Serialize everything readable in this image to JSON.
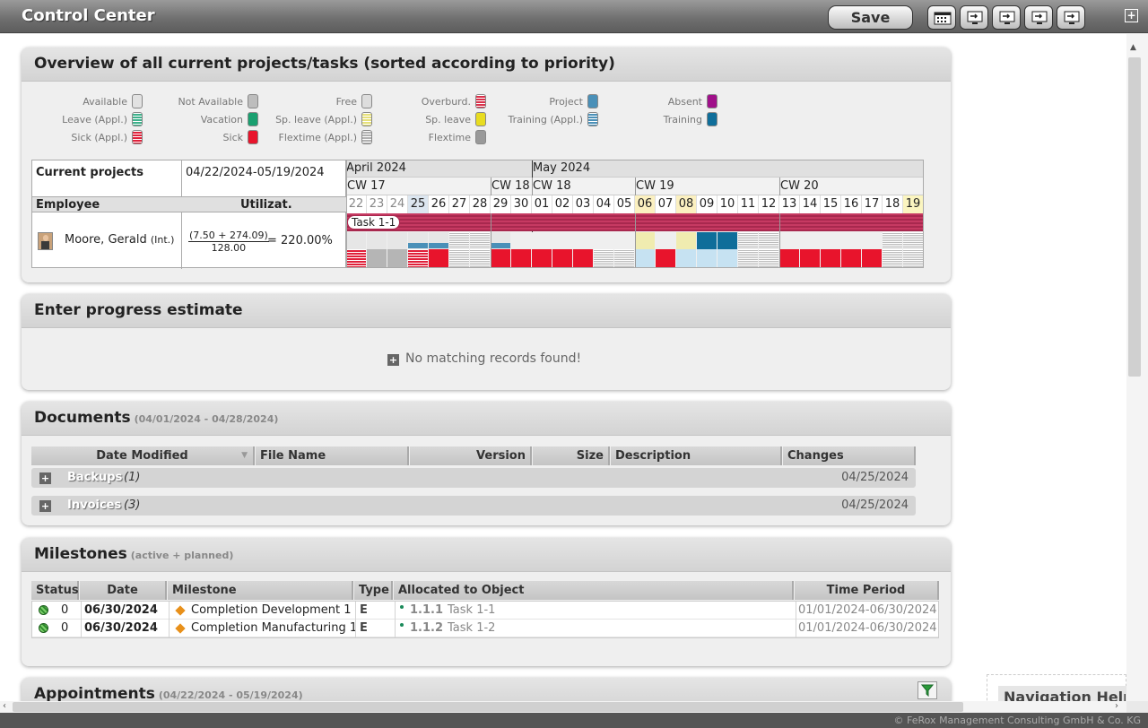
{
  "app": {
    "title": "Control Center",
    "save_label": "Save"
  },
  "projects_panel": {
    "title": "Overview of all current projects/tasks (sorted according to priority)",
    "legend": [
      {
        "label": "Available",
        "color": "#e2e2e2"
      },
      {
        "label": "Leave (Appl.)",
        "color": "#3cb08a"
      },
      {
        "label": "Sick (Appl.)",
        "color": "#e0203a"
      },
      {
        "label": "Not Available",
        "color": "#bdbdbd"
      },
      {
        "label": "Vacation",
        "color": "#1aa070"
      },
      {
        "label": "Sick",
        "color": "#e8142c"
      },
      {
        "label": "Free",
        "color": "#dddddd"
      },
      {
        "label": "Sp. leave (Appl.)",
        "color": "#e6e07a"
      },
      {
        "label": "Flextime (Appl.)",
        "color": "#b0b0b0"
      },
      {
        "label": "Overburd.",
        "color": "#d9304a"
      },
      {
        "label": "Sp. leave",
        "color": "#e8dc20"
      },
      {
        "label": "Flextime",
        "color": "#999999"
      },
      {
        "label": "Project",
        "color": "#4a90b8"
      },
      {
        "label": "Training (Appl.)",
        "color": "#4a90b8"
      },
      {
        "label": "Absent",
        "color": "#a0108a"
      },
      {
        "label": "Training",
        "color": "#0f6e9a"
      }
    ],
    "current_projects_label": "Current projects",
    "date_range": "04/22/2024-05/19/2024",
    "employee_header": "Employee",
    "utilization_header": "Utilizat.",
    "employee_name": "Moore, Gerald",
    "employee_type": "(Int.)",
    "util_numerator": "(7.50 + 274.09)",
    "util_denominator": "128.00",
    "util_result": "= 220.00%",
    "months": [
      "April 2024",
      "May 2024"
    ],
    "weeks": [
      "CW 17",
      "CW 18",
      "CW 18",
      "CW 19",
      "CW 20"
    ],
    "days": [
      "22",
      "23",
      "24",
      "25",
      "26",
      "27",
      "28",
      "29",
      "30",
      "01",
      "02",
      "03",
      "04",
      "05",
      "06",
      "07",
      "08",
      "09",
      "10",
      "11",
      "12",
      "13",
      "14",
      "15",
      "16",
      "17",
      "18",
      "19"
    ],
    "task_label": "Task 1-1"
  },
  "progress_panel": {
    "title": "Enter progress estimate",
    "empty_text": "No matching records found!"
  },
  "documents_panel": {
    "title": "Documents",
    "subtitle": "(04/01/2024 - 04/28/2024)",
    "columns": [
      "Date Modified",
      "File Name",
      "Version",
      "Size",
      "Description",
      "Changes"
    ],
    "groups": [
      {
        "name": "Backups",
        "count": "(1)",
        "date": "04/25/2024"
      },
      {
        "name": "Invoices",
        "count": "(3)",
        "date": "04/25/2024"
      }
    ]
  },
  "milestones_panel": {
    "title": "Milestones",
    "subtitle": "(active + planned)",
    "columns": [
      "Status",
      "Date",
      "Milestone",
      "Type",
      "Allocated to Object",
      "Time Period"
    ],
    "rows": [
      {
        "status": "0",
        "date": "06/30/2024",
        "milestone": "Completion Development 1",
        "type": "E",
        "obj_num": "1.1.1",
        "obj_name": "Task 1-1",
        "period": "01/01/2024-06/30/2024"
      },
      {
        "status": "0",
        "date": "06/30/2024",
        "milestone": "Completion Manufacturing 1",
        "type": "E",
        "obj_num": "1.1.2",
        "obj_name": "Task 1-2",
        "period": "01/01/2024-06/30/2024"
      }
    ]
  },
  "appointments_panel": {
    "title": "Appointments",
    "subtitle": "(04/22/2024 - 05/19/2024)"
  },
  "navigation_help": {
    "title": "Navigation Help"
  },
  "footer": {
    "copyright": "© FeRox Management Consulting GmbH & Co. KG"
  },
  "icons": [
    "calendar-icon",
    "monitor-arrow-icon",
    "filter-icon",
    "expand-icon",
    "milestone-diamond-icon",
    "status-dot-icon"
  ]
}
